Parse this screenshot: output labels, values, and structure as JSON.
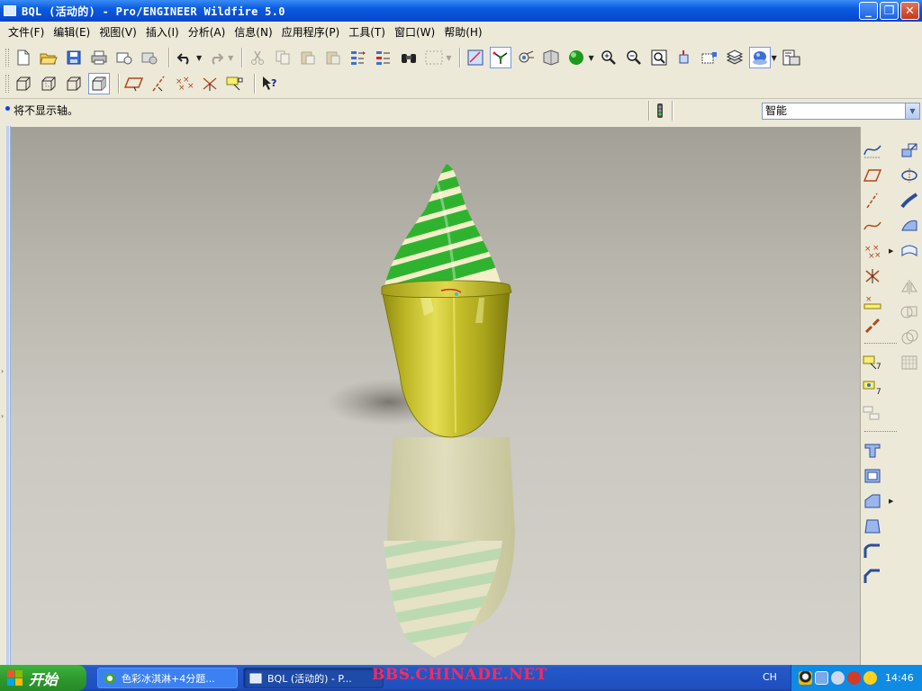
{
  "window": {
    "title": "BQL (活动的) - Pro/ENGINEER Wildfire 5.0",
    "minimize": "_",
    "restore": "❐",
    "close": "✕"
  },
  "menu": {
    "items": [
      "文件(F)",
      "编辑(E)",
      "视图(V)",
      "插入(I)",
      "分析(A)",
      "信息(N)",
      "应用程序(P)",
      "工具(T)",
      "窗口(W)",
      "帮助(H)"
    ]
  },
  "message": {
    "text": "将不显示轴。"
  },
  "filter": {
    "value": "智能"
  },
  "taskbar": {
    "start": "开始",
    "task1": "色彩冰淇淋+4分题...",
    "task2": "BQL (活动的) - P...",
    "watermark": "BBS.CHINADE.NET",
    "lang": "CH",
    "clock": "14:46"
  },
  "colors": {
    "titlebar": "#0a5be0",
    "cup": "#b8b21e",
    "swirl_green": "#2fb32f",
    "swirl_cream": "#f3efc9",
    "watermark": "#ff2a5a"
  },
  "icons": {
    "toolbar1": [
      "new-file-icon",
      "open-file-icon",
      "save-icon",
      "print-icon",
      "email-icon",
      "email-link-icon",
      "undo-icon",
      "redo-icon",
      "cut-icon",
      "copy-icon",
      "paste-icon",
      "paste-special-icon",
      "regenerate-icon",
      "regen-manager-icon",
      "find-icon",
      "select-box-icon",
      "repaint-icon",
      "spin-center-icon",
      "orient-mode-icon",
      "view-manager-icon",
      "appearance-icon",
      "zoom-in-icon",
      "zoom-out-icon",
      "refit-icon",
      "reorient-icon",
      "saved-views-icon",
      "layers-icon",
      "display-style-icon",
      "model-tree-icon"
    ],
    "toolbar2": [
      "wireframe-icon",
      "hidden-line-icon",
      "no-hidden-icon",
      "shading-icon",
      "datum-plane-display-icon",
      "datum-axis-display-icon",
      "datum-point-display-icon",
      "csys-display-icon",
      "annotation-display-icon",
      "context-help-icon"
    ]
  }
}
